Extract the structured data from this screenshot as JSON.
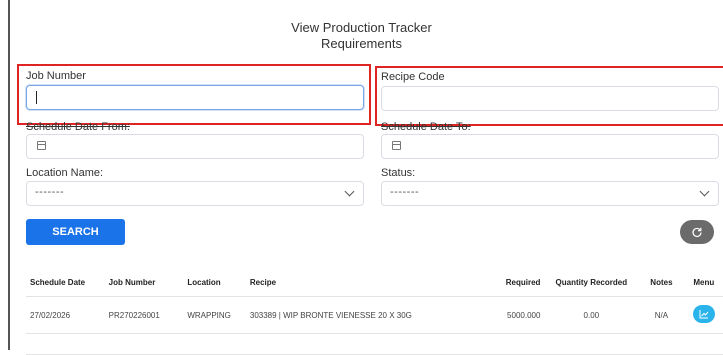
{
  "page": {
    "title_line1": "View Production Tracker",
    "title_line2": "Requirements"
  },
  "filters": {
    "job_number": {
      "label": "Job Number",
      "value": ""
    },
    "recipe_code": {
      "label": "Recipe Code",
      "value": ""
    },
    "schedule_date_from": {
      "label": "Schedule Date From:"
    },
    "schedule_date_to": {
      "label": "Schedule Date To:"
    },
    "location_name": {
      "label": "Location Name:",
      "selected": "-------"
    },
    "status": {
      "label": "Status:",
      "selected": "-------"
    }
  },
  "buttons": {
    "search_label": "SEARCH",
    "reset_icon": "refresh-icon"
  },
  "table": {
    "headers": [
      "Schedule Date",
      "Job Number",
      "Location",
      "Recipe",
      "Required",
      "Quantity Recorded",
      "Notes",
      "Menu"
    ],
    "rows": [
      {
        "schedule_date": "27/02/2026",
        "job_number": "PR270226001",
        "location": "WRAPPING",
        "recipe": "303389 | WIP BRONTE VIENESSE 20 X 30G",
        "required": "5000.000",
        "quantity_recorded": "0.00",
        "notes": "N/A",
        "menu_icon": "chart-icon"
      }
    ]
  },
  "colors": {
    "primary_button": "#1a73e8",
    "reset_button": "#6b6b6b",
    "menu_button": "#2bb4ec",
    "highlight": "#e02424"
  }
}
